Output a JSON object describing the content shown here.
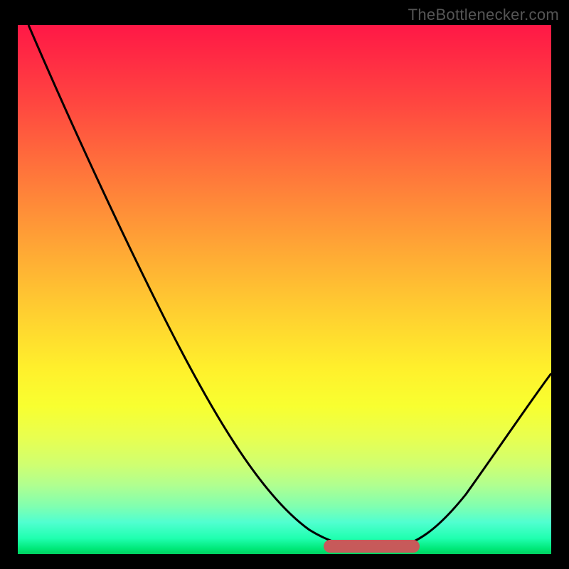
{
  "attribution": "TheBottlenecker.com",
  "chart_data": {
    "type": "line",
    "title": "",
    "xlabel": "",
    "ylabel": "",
    "xlim": [
      0,
      100
    ],
    "ylim": [
      0,
      100
    ],
    "curve_points": [
      {
        "x": 2,
        "y": 100
      },
      {
        "x": 10,
        "y": 80
      },
      {
        "x": 20,
        "y": 60
      },
      {
        "x": 30,
        "y": 42
      },
      {
        "x": 40,
        "y": 26
      },
      {
        "x": 48,
        "y": 14
      },
      {
        "x": 55,
        "y": 6
      },
      {
        "x": 60,
        "y": 2
      },
      {
        "x": 65,
        "y": 0.5
      },
      {
        "x": 70,
        "y": 0.5
      },
      {
        "x": 75,
        "y": 2
      },
      {
        "x": 80,
        "y": 7
      },
      {
        "x": 88,
        "y": 18
      },
      {
        "x": 95,
        "y": 28
      },
      {
        "x": 100,
        "y": 34
      }
    ],
    "accent_range": {
      "xmin": 59,
      "xmax": 76,
      "y": 2
    },
    "gradient_colors": {
      "top": "#ff1846",
      "mid": "#fff02c",
      "bottom": "#00d060"
    }
  }
}
